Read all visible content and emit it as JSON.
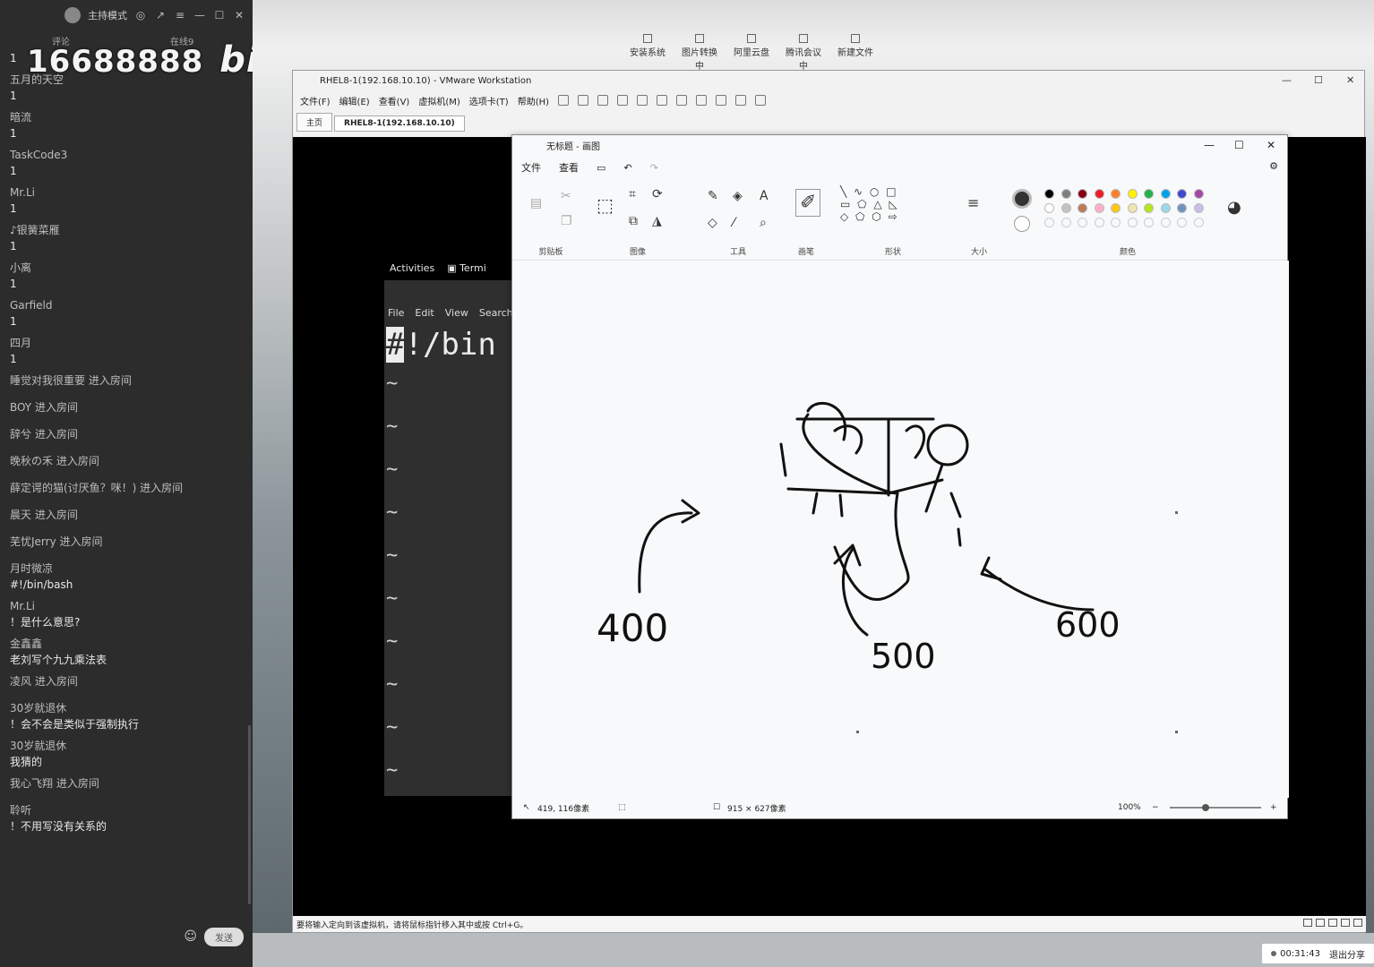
{
  "chat": {
    "top_mode": "主持模式",
    "tabs": [
      "评论",
      "在线9"
    ],
    "overlay_number": "16688888",
    "overlay_logo": "bilibili",
    "messages": [
      {
        "user": "",
        "text": "1"
      },
      {
        "user": "五月的天空",
        "text": "1"
      },
      {
        "user": "暗流",
        "text": "1"
      },
      {
        "user": "TaskCode3",
        "text": "1"
      },
      {
        "user": "Mr.Li",
        "text": "1"
      },
      {
        "user": "♪银簧菜雁",
        "text": "1"
      },
      {
        "user": "小离",
        "text": "1"
      },
      {
        "user": "Garfield",
        "text": "1"
      },
      {
        "user": "四月",
        "text": "1"
      }
    ],
    "enters_1": [
      "睡觉对我很重要 进入房间",
      "BOY 进入房间",
      "辞兮 进入房间",
      "晚秋の禾 进入房间",
      "薛定谔的猫(讨厌鱼？咪！) 进入房间",
      "晨天 进入房间",
      "芜忧Jerry 进入房间"
    ],
    "messages_2": [
      {
        "user": "月时微凉",
        "text": "#!/bin/bash"
      },
      {
        "user": "Mr.Li",
        "text": "！是什么意思?"
      },
      {
        "user": "金鑫鑫",
        "text": "老刘写个九九乘法表"
      }
    ],
    "enter_2": "凌风 进入房间",
    "messages_3": [
      {
        "user": "30岁就退休",
        "text": "！会不会是类似于强制执行"
      },
      {
        "user": "30岁就退休",
        "text": "我猜的"
      }
    ],
    "enter_3": "我心飞翔 进入房间",
    "messages_4": [
      {
        "user": "聆听",
        "text": "！不用写没有关系的"
      }
    ],
    "send_label": "发送"
  },
  "desktop": {
    "taskbar_items": [
      "安装系统",
      "图片转换中",
      "阿里云盘",
      "腾讯会议中",
      "新建文件"
    ],
    "share": {
      "time": "00:31:43",
      "exit_label": "退出分享"
    }
  },
  "vmware": {
    "title": "RHEL8-1(192.168.10.10) - VMware Workstation",
    "menu": [
      "文件(F)",
      "编辑(E)",
      "查看(V)",
      "虚拟机(M)",
      "选项卡(T)",
      "帮助(H)"
    ],
    "tabs": [
      {
        "label": "主页"
      },
      {
        "label": "RHEL8-1(192.168.10.10)"
      }
    ],
    "status_text": "要将输入定向到该虚拟机，请将鼠标指针移入其中或按 Ctrl+G。",
    "gnome": {
      "activities": "Activities",
      "terminal": "Termi"
    },
    "terminal": {
      "menu": [
        "File",
        "Edit",
        "View",
        "Search"
      ],
      "cursor_char": "#",
      "line1": "!/bin",
      "tilde_count": 10,
      "tilde": "~"
    }
  },
  "paint": {
    "title": "无标题 - 画图",
    "menu": [
      "文件",
      "查看"
    ],
    "groups": [
      "剪贴板",
      "图像",
      "工具",
      "画笔",
      "形状",
      "大小",
      "颜色"
    ],
    "status": {
      "cursor": "419, 116像素",
      "size": "915 × 627像素",
      "zoom": "100%"
    },
    "drawing_labels": [
      "400",
      "500",
      "600"
    ],
    "colors_row1": [
      "#000000",
      "#7f7f7f",
      "#880015",
      "#ed1c24",
      "#ff7f27",
      "#fff200",
      "#22b14c",
      "#00a2e8",
      "#3f48cc",
      "#a349a4"
    ],
    "colors_row2": [
      "#ffffff",
      "#c3c3c3",
      "#b97a57",
      "#ffaec9",
      "#ffc90e",
      "#efe4b0",
      "#b5e61d",
      "#99d9ea",
      "#7092be",
      "#c8bfe7"
    ]
  }
}
